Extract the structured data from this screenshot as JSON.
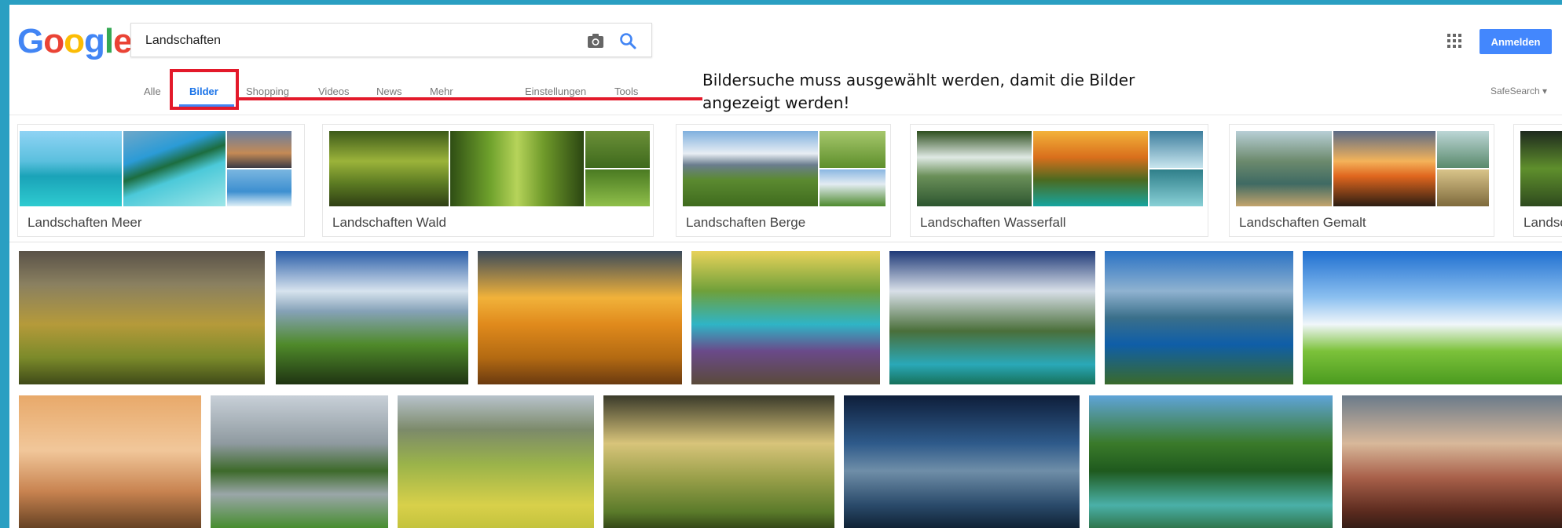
{
  "logo": {
    "letters": [
      "G",
      "o",
      "o",
      "g",
      "l",
      "e"
    ],
    "colors": [
      "#4285f4",
      "#ea4335",
      "#fbbc05",
      "#4285f4",
      "#34a853",
      "#ea4335"
    ]
  },
  "search": {
    "value": "Landschaften"
  },
  "header": {
    "signin_label": "Anmelden"
  },
  "tabs": [
    "Alle",
    "Bilder",
    "Shopping",
    "Videos",
    "News",
    "Mehr",
    "Einstellungen",
    "Tools"
  ],
  "safesearch_label": "SafeSearch ▾",
  "annotation": {
    "line1": "Bildersuche muss ausgewählt werden, damit die Bilder",
    "line2": "angezeigt werden!"
  },
  "related": [
    {
      "label": "Landschaften Meer"
    },
    {
      "label": "Landschaften Wald"
    },
    {
      "label": "Landschaften Berge"
    },
    {
      "label": "Landschaften Wasserfall"
    },
    {
      "label": "Landschaften Gemalt"
    },
    {
      "label": "Landsch"
    }
  ],
  "colors": {
    "accent": "#4285f4",
    "signin": "#4387fd",
    "annotation_red": "#e3192a"
  }
}
